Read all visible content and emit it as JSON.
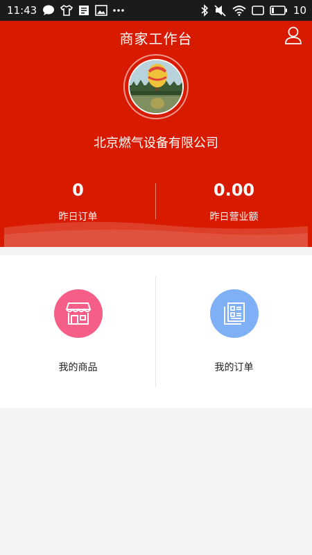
{
  "status_bar": {
    "time": "11:43",
    "battery": "10",
    "left_icons": [
      "chat-icon",
      "shirt-icon",
      "document-icon",
      "image-icon",
      "more-dots-icon"
    ],
    "right_icons": [
      "bluetooth-icon",
      "mute-icon",
      "wifi-icon",
      "window-icon",
      "battery-icon"
    ]
  },
  "header": {
    "title": "商家工作台",
    "user_icon": "person-icon",
    "company_name": "北京燃气设备有限公司",
    "avatar": "hot-air-balloon-photo",
    "colors": {
      "background": "#d81b00",
      "text": "#ffffff"
    }
  },
  "stats": [
    {
      "value": "0",
      "label": "昨日订单"
    },
    {
      "value": "0.00",
      "label": "昨日营业额"
    }
  ],
  "menu": [
    {
      "label": "我的商品",
      "icon": "shop-icon",
      "color": "#f55f87"
    },
    {
      "label": "我的订单",
      "icon": "order-list-icon",
      "color": "#7fb0f5"
    }
  ]
}
